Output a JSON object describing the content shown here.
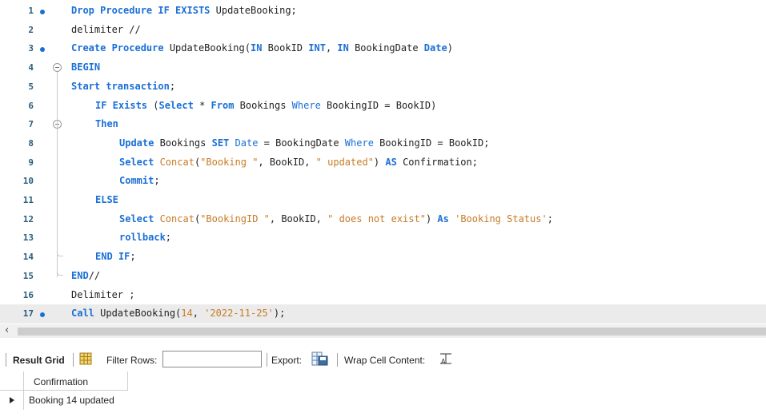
{
  "editor": {
    "lines": [
      {
        "n": "1",
        "dot": true,
        "parts": [
          [
            "k",
            "Drop Procedure IF EXISTS "
          ],
          [
            "n",
            "UpdateBooking;"
          ]
        ]
      },
      {
        "n": "2",
        "parts": [
          [
            "n",
            "delimiter //"
          ]
        ]
      },
      {
        "n": "3",
        "dot": true,
        "parts": [
          [
            "k",
            "Create Procedure "
          ],
          [
            "n",
            "UpdateBooking("
          ],
          [
            "k",
            "IN "
          ],
          [
            "n",
            "BookID "
          ],
          [
            "k",
            "INT"
          ],
          [
            "n",
            ", "
          ],
          [
            "k",
            "IN "
          ],
          [
            "n",
            "BookingDate "
          ],
          [
            "k",
            "Date"
          ],
          [
            "n",
            ")"
          ]
        ]
      },
      {
        "n": "4",
        "fold": true,
        "parts": [
          [
            "k",
            "BEGIN"
          ]
        ]
      },
      {
        "n": "5",
        "parts": [
          [
            "k",
            "Start transaction"
          ],
          [
            "n",
            ";"
          ]
        ]
      },
      {
        "n": "6",
        "indent": 1,
        "parts": [
          [
            "k",
            "IF Exists "
          ],
          [
            "n",
            "("
          ],
          [
            "k",
            "Select "
          ],
          [
            "n",
            "* "
          ],
          [
            "k",
            "From "
          ],
          [
            "n",
            "Bookings "
          ],
          [
            "f",
            "Where "
          ],
          [
            "n",
            "BookingID = BookID)"
          ]
        ]
      },
      {
        "n": "7",
        "indent": 1,
        "fold": true,
        "parts": [
          [
            "k",
            "Then"
          ]
        ]
      },
      {
        "n": "8",
        "indent": 2,
        "parts": [
          [
            "k",
            "Update "
          ],
          [
            "n",
            "Bookings "
          ],
          [
            "k",
            "SET "
          ],
          [
            "f",
            "Date "
          ],
          [
            "n",
            "= BookingDate "
          ],
          [
            "f",
            "Where "
          ],
          [
            "n",
            "BookingID = BookID;"
          ]
        ]
      },
      {
        "n": "9",
        "indent": 2,
        "parts": [
          [
            "k",
            "Select "
          ],
          [
            "s",
            "Concat"
          ],
          [
            "n",
            "("
          ],
          [
            "s",
            "\"Booking \""
          ],
          [
            "n",
            ", BookID, "
          ],
          [
            "s",
            "\" updated\""
          ],
          [
            "n",
            ") "
          ],
          [
            "k",
            "AS "
          ],
          [
            "n",
            "Confirmation;"
          ]
        ]
      },
      {
        "n": "10",
        "indent": 2,
        "parts": [
          [
            "k",
            "Commit"
          ],
          [
            "n",
            ";"
          ]
        ]
      },
      {
        "n": "11",
        "indent": 1,
        "parts": [
          [
            "k",
            "ELSE"
          ]
        ]
      },
      {
        "n": "12",
        "indent": 2,
        "parts": [
          [
            "k",
            "Select "
          ],
          [
            "s",
            "Concat"
          ],
          [
            "n",
            "("
          ],
          [
            "s",
            "\"BookingID \""
          ],
          [
            "n",
            ", BookID, "
          ],
          [
            "s",
            "\" does not exist\""
          ],
          [
            "n",
            ") "
          ],
          [
            "k",
            "As "
          ],
          [
            "s",
            "'Booking Status'"
          ],
          [
            "n",
            ";"
          ]
        ]
      },
      {
        "n": "13",
        "indent": 2,
        "parts": [
          [
            "k",
            "rollback"
          ],
          [
            "n",
            ";"
          ]
        ]
      },
      {
        "n": "14",
        "indent": 1,
        "parts": [
          [
            "k",
            "END IF"
          ],
          [
            "n",
            ";"
          ]
        ]
      },
      {
        "n": "15",
        "parts": [
          [
            "k",
            "END"
          ],
          [
            "n",
            "//"
          ]
        ]
      },
      {
        "n": "16",
        "parts": [
          [
            "n",
            "Delimiter ;"
          ]
        ]
      },
      {
        "n": "17",
        "dot": true,
        "active": true,
        "parts": [
          [
            "k",
            "Call "
          ],
          [
            "n",
            "UpdateBooking("
          ],
          [
            "s",
            "14"
          ],
          [
            "n",
            ", "
          ],
          [
            "s",
            "'2022-11-25'"
          ],
          [
            "n",
            ");"
          ]
        ]
      }
    ]
  },
  "scroll": {
    "left_arrow": "‹"
  },
  "toolbar": {
    "result_grid": "Result Grid",
    "filter_rows": "Filter Rows:",
    "filter_value": "",
    "export": "Export:",
    "wrap": "Wrap Cell Content:"
  },
  "grid": {
    "column": "Confirmation",
    "rows": [
      "Booking 14 updated"
    ]
  },
  "colors": {
    "keyword": "#1a6fd6",
    "string": "#c87a25",
    "line_number": "#2a5d7c",
    "active_line": "#ebebeb"
  }
}
